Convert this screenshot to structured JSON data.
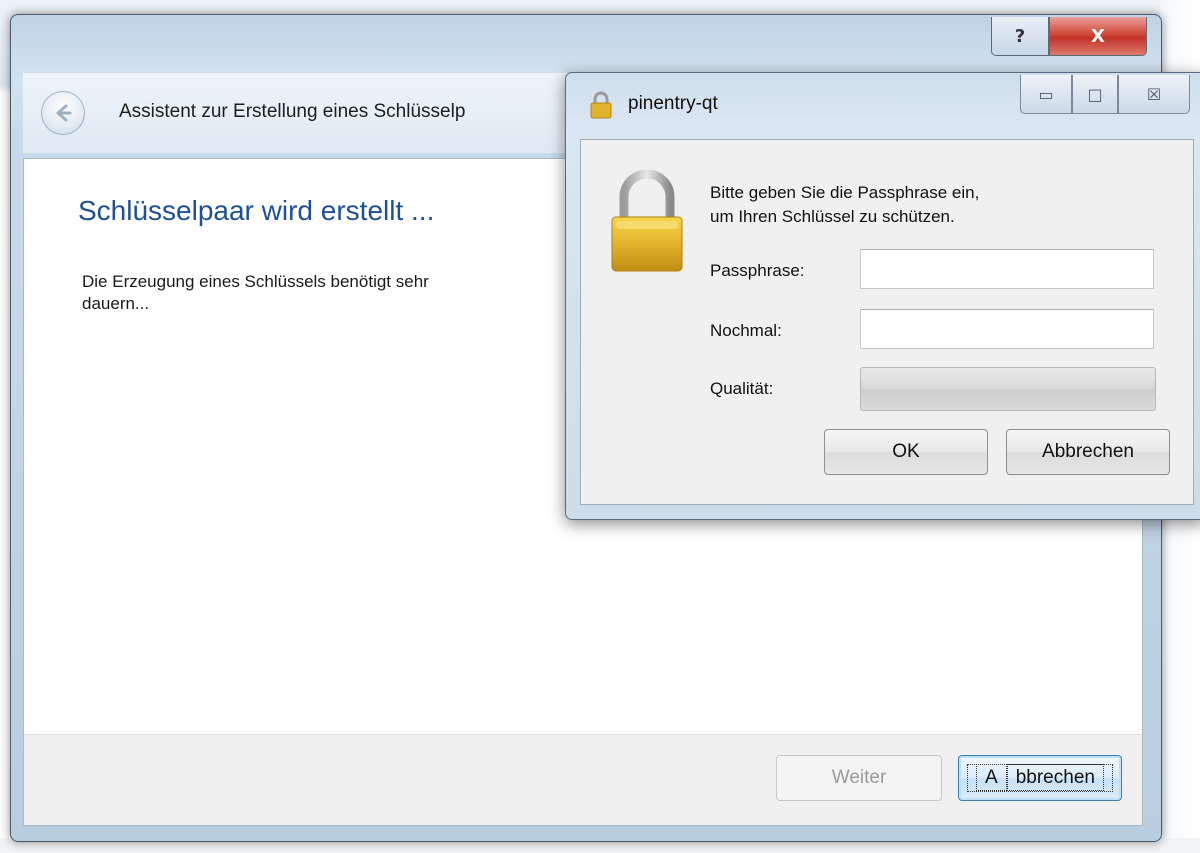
{
  "wizard": {
    "title": "Assistent zur Erstellung eines Schlüsselp",
    "heading": "Schlüsselpaar wird erstellt ...",
    "body": "Die Erzeugung eines Schlüssels benötigt sehr",
    "body_line2": "dauern...",
    "help_glyph": "?",
    "close_glyph": "X",
    "next_button": {
      "accel": "W",
      "rest": "eiter",
      "enabled": false
    },
    "cancel_button": {
      "accel": "A",
      "rest": "bbrechen"
    }
  },
  "pinentry": {
    "title": "pinentry-qt",
    "message_line1": "Bitte geben Sie die Passphrase ein,",
    "message_line2": "um Ihren Schlüssel zu schützen.",
    "passphrase_label": "Passphrase:",
    "passphrase_value": "",
    "repeat_label": "Nochmal:",
    "repeat_value": "",
    "quality_label": "Qualität:",
    "quality_level": 0,
    "ok_label": "OK",
    "cancel_label": "Abbrechen",
    "minimize_glyph": "▭",
    "maximize_glyph": "□",
    "close_glyph": "☒"
  },
  "colors": {
    "heading": "#1f4f94",
    "lock_gold": "#e3b22b",
    "close_red": "#c3322a"
  },
  "icons": [
    "back-arrow-icon",
    "lock-icon",
    "help-icon",
    "close-icon",
    "minimize-icon",
    "maximize-icon"
  ]
}
